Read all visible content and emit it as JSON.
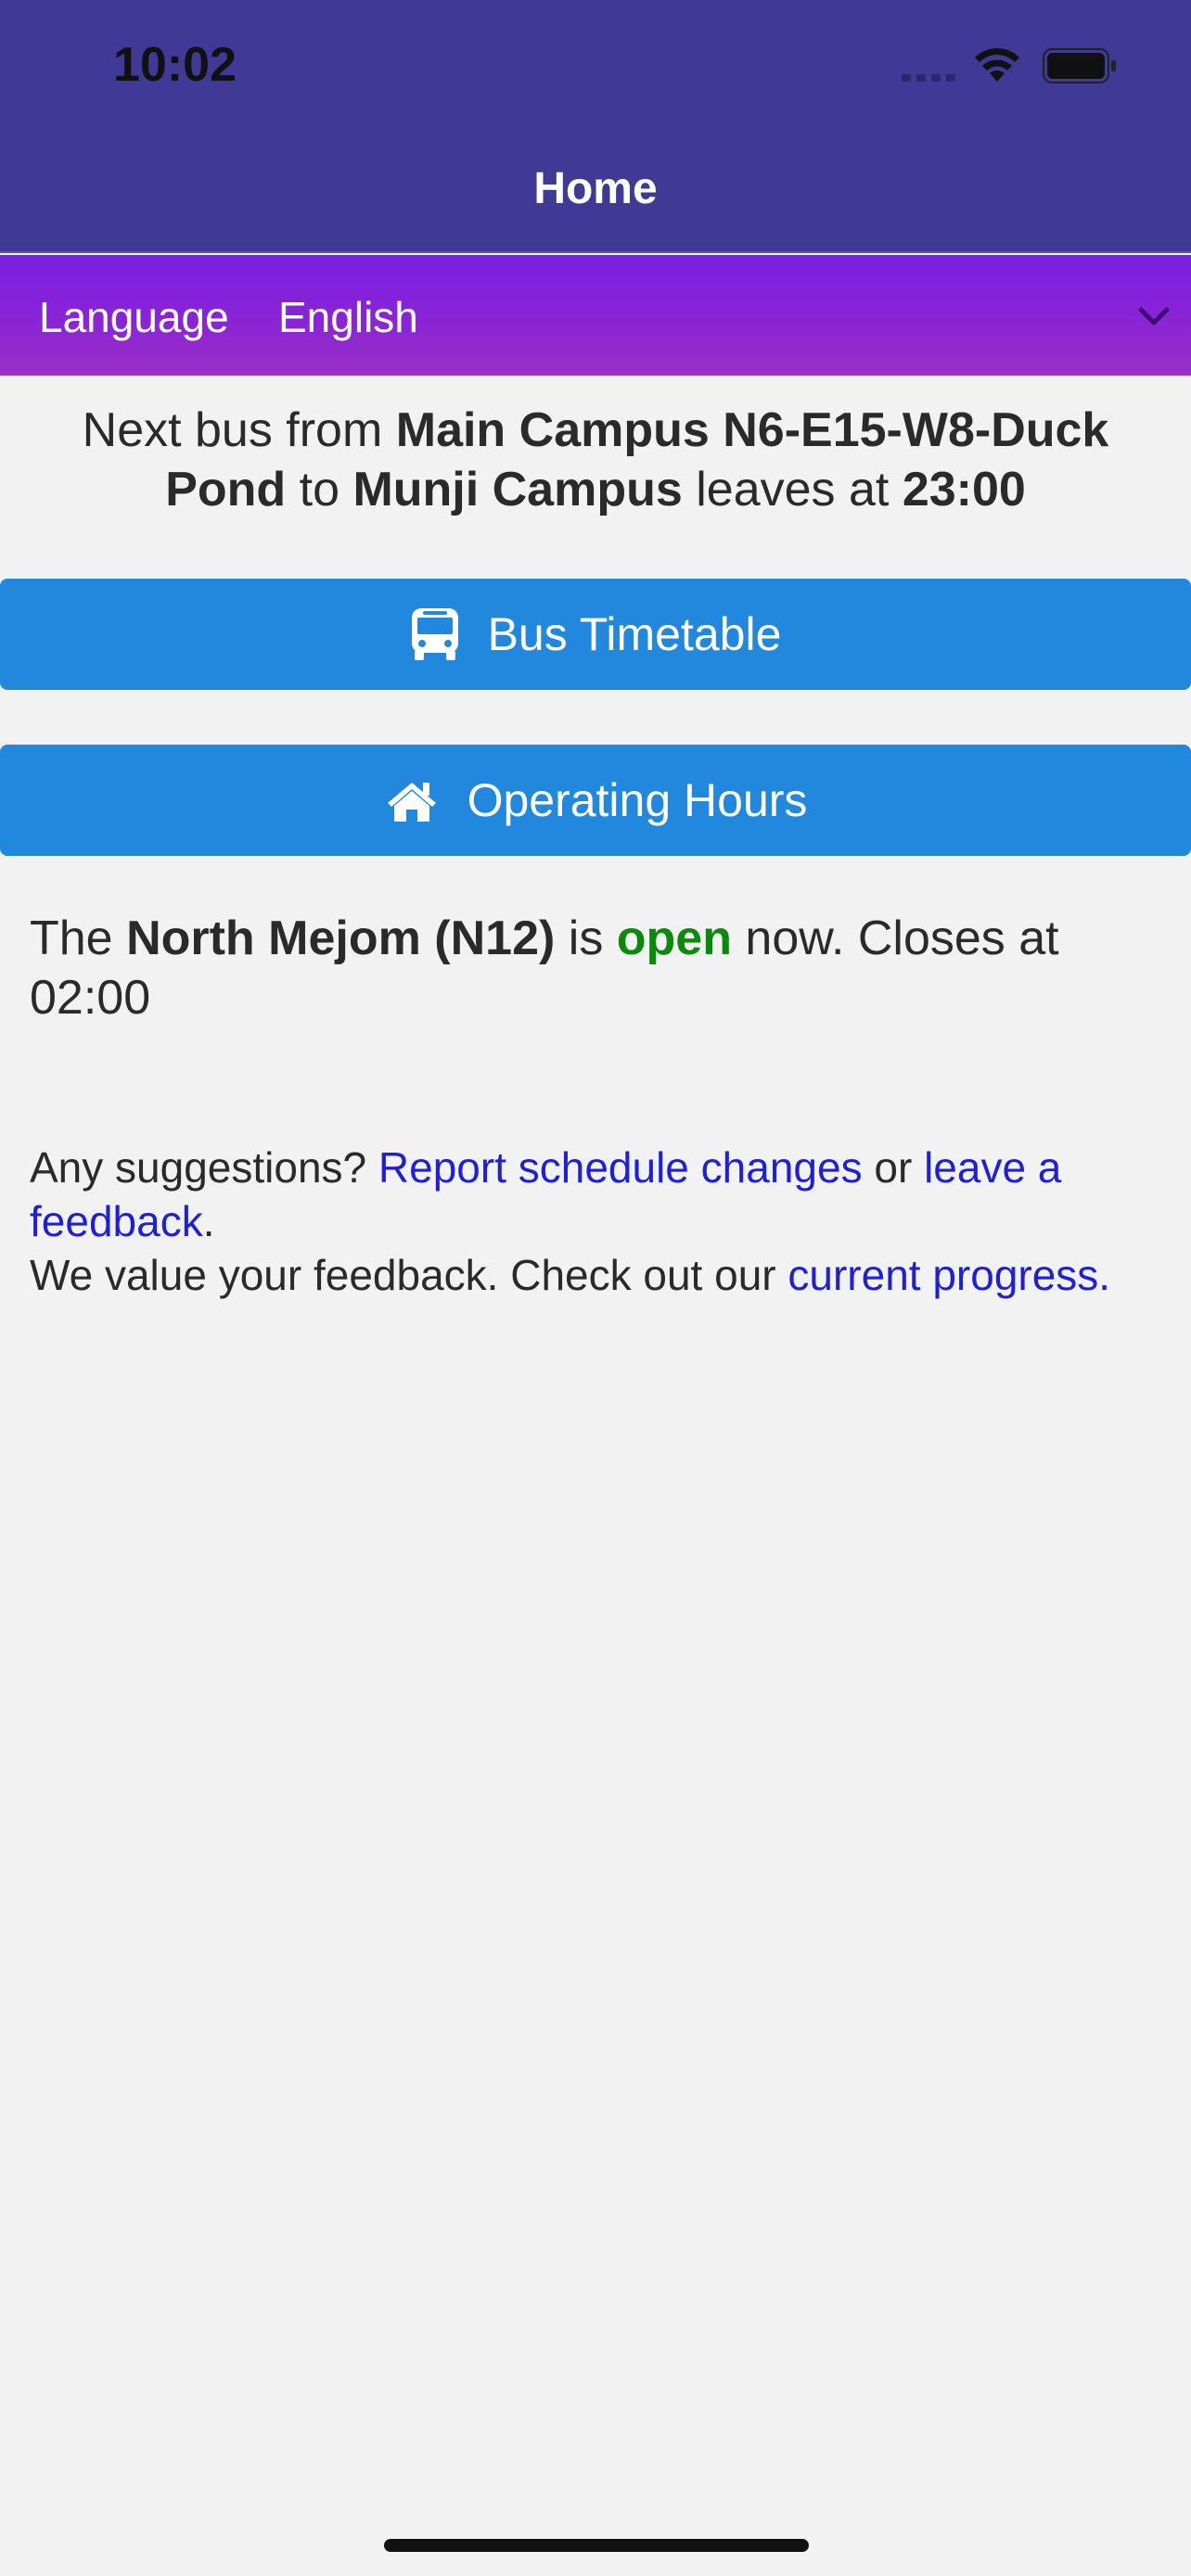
{
  "status_bar": {
    "time": "10:02"
  },
  "header": {
    "title": "Home"
  },
  "language": {
    "label": "Language",
    "value": "English"
  },
  "next_bus": {
    "prefix": "Next bus from ",
    "origin": "Main Campus N6-E15-W8-Duck Pond",
    "to_word": " to ",
    "destination": "Munji Campus",
    "leaves_at_text": " leaves at ",
    "time": "23:00"
  },
  "buttons": {
    "bus_timetable": {
      "label": "Bus Timetable",
      "icon": "bus-icon"
    },
    "operating_hours": {
      "label": "Operating Hours",
      "icon": "home-icon"
    }
  },
  "facility_status": {
    "prefix": "The ",
    "name": "North Mejom (N12)",
    "is_word": " is ",
    "status": "open",
    "suffix": " now. Closes at 02:00"
  },
  "feedback": {
    "question": "Any suggestions? ",
    "report_link": "Report schedule changes",
    "or_word": " or ",
    "leave_feedback_link": "leave a feedback",
    "period": ".",
    "value_text": "We value your feedback. Check out our ",
    "progress_link": "current progress."
  },
  "colors": {
    "header_bg": "#3f3a96",
    "language_bar": "#8a24d6",
    "button_bg": "#2188dd",
    "open_status": "#0a8a0a",
    "link": "#1f1fd6"
  }
}
